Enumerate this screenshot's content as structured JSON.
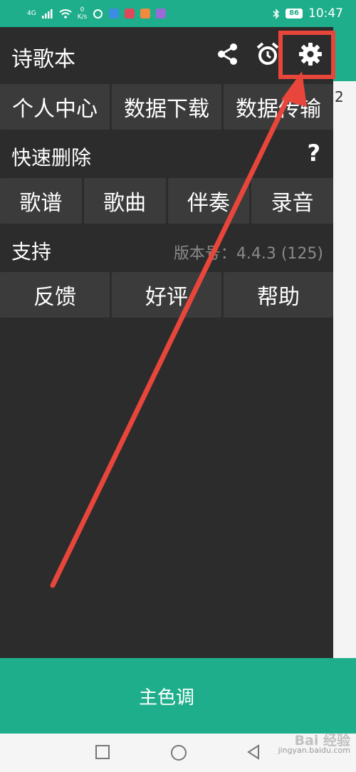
{
  "status_bar": {
    "network": "4G",
    "speed_value": "0",
    "speed_unit": "K/s",
    "battery": "86",
    "time": "10:47"
  },
  "header": {
    "title": "诗歌本",
    "share_icon": "share-icon",
    "alarm_icon": "alarm-icon",
    "settings_icon": "gear-icon"
  },
  "top_buttons": [
    "个人中心",
    "数据下载",
    "数据传输"
  ],
  "quick_delete": {
    "label": "快速删除",
    "help": "?",
    "buttons": [
      "歌谱",
      "歌曲",
      "伴奏",
      "录音"
    ]
  },
  "support": {
    "label": "支持",
    "version": "版本号：4.4.3 (125)",
    "buttons": [
      "反馈",
      "好评",
      "帮助"
    ]
  },
  "bottom_bar": {
    "label": "主色调"
  },
  "backdrop_text": {
    "top": "2"
  },
  "watermark": {
    "main": "Bai 经验",
    "sub": "jingyan.baidu.com"
  },
  "colors": {
    "accent": "#1fae8b",
    "drawer": "#2c2c2c",
    "button": "#3b3b3b",
    "highlight": "#e8463a"
  }
}
